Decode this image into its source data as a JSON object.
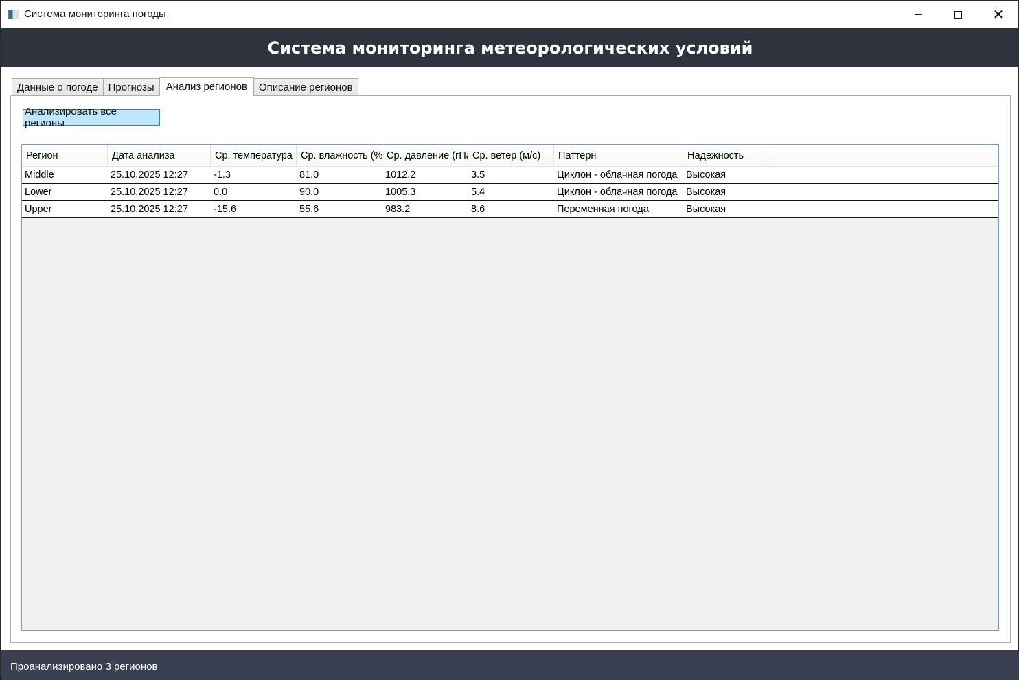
{
  "window": {
    "title": "Система мониторинга погоды",
    "icon": "app-window-icon",
    "controls": {
      "minimize": "minimize-icon",
      "maximize": "maximize-icon",
      "close": "close-icon"
    }
  },
  "header": {
    "title": "Система мониторинга метеорологических условий"
  },
  "tabs": [
    {
      "label": "Данные о погоде",
      "active": false
    },
    {
      "label": "Прогнозы",
      "active": false
    },
    {
      "label": "Анализ регионов",
      "active": true
    },
    {
      "label": "Описание регионов",
      "active": false
    }
  ],
  "actions": {
    "analyze_all_label": "Анализировать все регионы"
  },
  "table": {
    "columns": [
      "Регион",
      "Дата анализа",
      "Ср. температура",
      "Ср. влажность (%)",
      "Ср. давление (гПа)",
      "Ср. ветер (м/с)",
      "Паттерн",
      "Надежность"
    ],
    "rows": [
      [
        "Middle",
        "25.10.2025 12:27",
        "-1.3",
        "81.0",
        "1012.2",
        "3.5",
        "Циклон - облачная погода",
        "Высокая"
      ],
      [
        "Lower",
        "25.10.2025 12:27",
        "0.0",
        "90.0",
        "1005.3",
        "5.4",
        "Циклон - облачная погода",
        "Высокая"
      ],
      [
        "Upper",
        "25.10.2025 12:27",
        "-15.6",
        "55.6",
        "983.2",
        "8.6",
        "Переменная погода",
        "Высокая"
      ]
    ]
  },
  "status": {
    "text": "Проанализировано 3 регионов"
  },
  "colors": {
    "header_bg": "#2e333d",
    "status_bg": "#3a4050",
    "button_bg": "#bee6fd",
    "button_border": "#3c7fb1",
    "grid_empty": "#f0f0f0"
  }
}
